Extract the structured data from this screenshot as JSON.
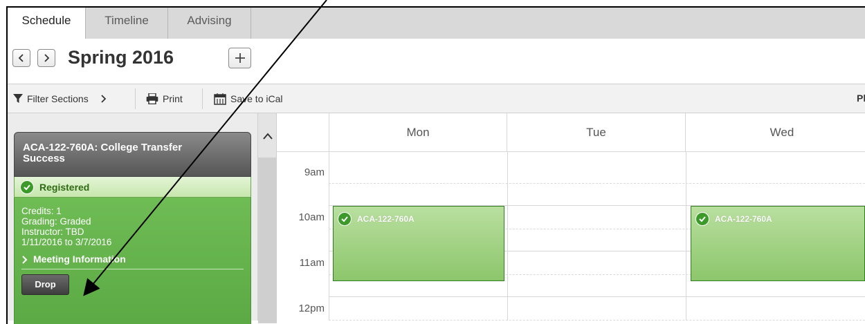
{
  "tabs": [
    "Schedule",
    "Timeline",
    "Advising"
  ],
  "term": {
    "title": "Spring 2016"
  },
  "toolbar": {
    "filter": "Filter Sections",
    "print": "Print",
    "ical": "Save to iCal",
    "plan": "Pla"
  },
  "course_card": {
    "title_line1": "ACA-122-760A: College Transfer",
    "title_line2": "Success",
    "status": "Registered",
    "credits": "Credits: 1",
    "grading": "Grading: Graded",
    "instructor": "Instructor: TBD",
    "dates": "1/11/2016 to 3/7/2016",
    "meeting_info": "Meeting Information",
    "drop": "Drop"
  },
  "calendar": {
    "days": [
      "Mon",
      "Tue",
      "Wed"
    ],
    "times": [
      "9am",
      "10am",
      "11am",
      "12pm"
    ],
    "events": [
      {
        "day": "Mon",
        "label": "ACA-122-760A"
      },
      {
        "day": "Wed",
        "label": "ACA-122-760A"
      }
    ]
  },
  "colors": {
    "registered_green": "#5fae47",
    "event_green": "#9fd27f",
    "header_gray": "#6a6a6a"
  },
  "icons": [
    "chevron-left-icon",
    "chevron-right-icon",
    "plus-icon",
    "filter-icon",
    "printer-icon",
    "calendar-icon",
    "check-circle-icon",
    "chevron-up-icon"
  ]
}
